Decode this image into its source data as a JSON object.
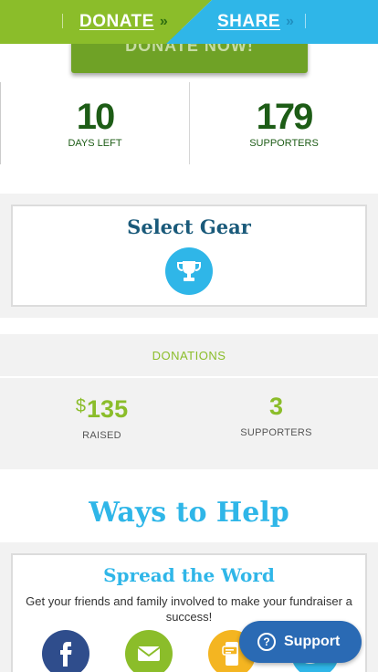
{
  "header": {
    "donate_label": "DONATE",
    "share_label": "SHARE",
    "arrow_glyph": "»",
    "colors": {
      "donate": "#8bbd2a",
      "share": "#2fb6e8"
    }
  },
  "hero": {
    "donate_now_label": "DONATE NOW!"
  },
  "stats": {
    "days_left_value": "10",
    "days_left_label": "DAYS LEFT",
    "supporters_value": "179",
    "supporters_label": "SUPPORTERS"
  },
  "gear": {
    "title": "Select Gear",
    "icon": "trophy-icon"
  },
  "donations": {
    "heading": "DONATIONS",
    "raised_currency": "$",
    "raised_value": "135",
    "raised_label": "RAISED",
    "supporters_value": "3",
    "supporters_label": "SUPPORTERS"
  },
  "ways_to_help": {
    "title": "Ways to Help",
    "spread_title": "Spread the Word",
    "spread_text": "Get your friends and family involved to make your fundraiser a success!",
    "social_icons": [
      "facebook-icon",
      "email-icon",
      "text-message-icon",
      "twitter-icon"
    ]
  },
  "support_button": {
    "label": "Support",
    "icon": "question-icon"
  }
}
